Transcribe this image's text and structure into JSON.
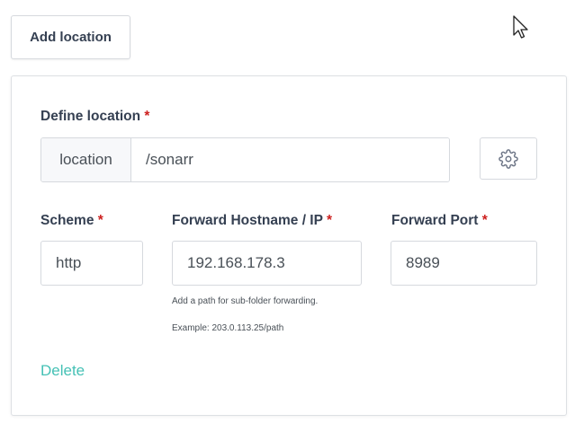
{
  "add_location_button": "Add location",
  "form": {
    "define_location": {
      "label": "Define location",
      "required_marker": "*",
      "addon": "location",
      "value": "/sonarr"
    },
    "scheme": {
      "label": "Scheme",
      "required_marker": "*",
      "value": "http"
    },
    "forward_hostname": {
      "label": "Forward Hostname / IP",
      "required_marker": "*",
      "value": "192.168.178.3",
      "help_line1": "Add a path for sub-folder forwarding.",
      "help_line2": "Example: 203.0.113.25/path"
    },
    "forward_port": {
      "label": "Forward Port",
      "required_marker": "*",
      "value": "8989"
    },
    "delete_link": "Delete"
  },
  "icons": {
    "settings": "gear-icon",
    "cursor": "mouse-pointer"
  },
  "colors": {
    "required": "#cd201f",
    "delete_link": "#45c1b5",
    "text": "#354052"
  }
}
